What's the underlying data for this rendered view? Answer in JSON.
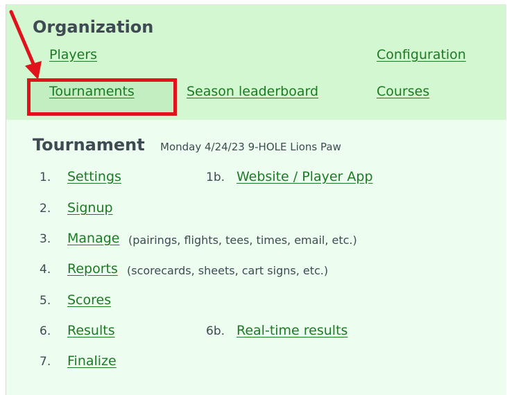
{
  "organization": {
    "title": "Organization",
    "links": {
      "players": "Players",
      "configuration": "Configuration",
      "tournaments": "Tournaments",
      "season_leaderboard": "Season leaderboard",
      "courses": "Courses"
    }
  },
  "tournament": {
    "title": "Tournament",
    "subtitle": "Monday 4/24/23 9-HOLE Lions Paw",
    "steps": [
      {
        "num": "1.",
        "label": "Settings",
        "note": ""
      },
      {
        "num": "2.",
        "label": "Signup",
        "note": ""
      },
      {
        "num": "3.",
        "label": "Manage",
        "note": "(pairings, flights, tees, times, email, etc.)"
      },
      {
        "num": "4.",
        "label": "Reports",
        "note": "(scorecards, sheets, cart signs, etc.)"
      },
      {
        "num": "5.",
        "label": "Scores",
        "note": ""
      },
      {
        "num": "6.",
        "label": "Results",
        "note": ""
      },
      {
        "num": "7.",
        "label": "Finalize",
        "note": ""
      }
    ],
    "extra_steps": [
      {
        "num": "1b.",
        "label": "Website / Player App"
      },
      {
        "num": "6b.",
        "label": "Real-time results"
      }
    ]
  },
  "annotation": {
    "arrow_color": "#e0121b",
    "highlight_color": "#e0121b"
  },
  "colors": {
    "org_bg": "#d3f7d0",
    "tournament_bg": "#edfdf0",
    "link": "#1d7a24",
    "text": "#404a52"
  }
}
